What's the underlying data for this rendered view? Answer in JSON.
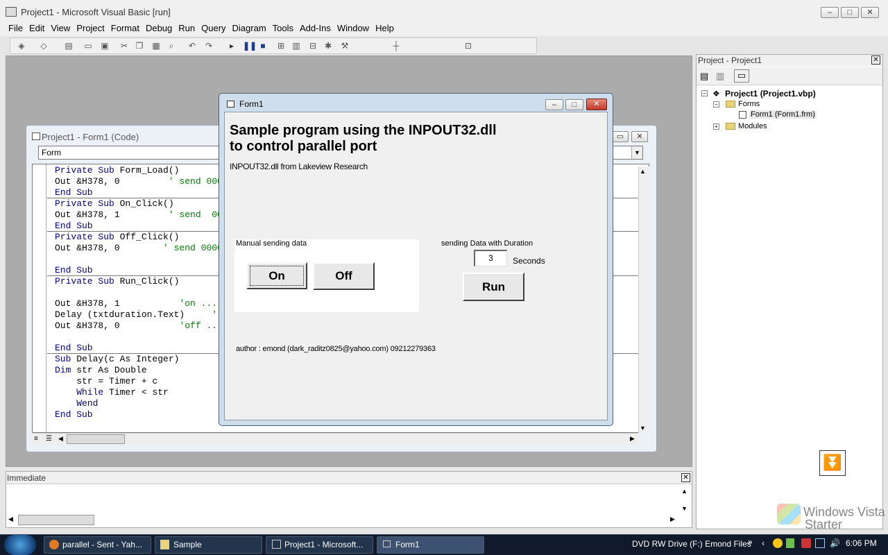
{
  "app": {
    "title": "Project1 - Microsoft Visual Basic [run]"
  },
  "menu": [
    "File",
    "Edit",
    "View",
    "Project",
    "Format",
    "Debug",
    "Run",
    "Query",
    "Diagram",
    "Tools",
    "Add-Ins",
    "Window",
    "Help"
  ],
  "code_window": {
    "title": "Project1 - Form1 (Code)",
    "object_combo": "Form",
    "lines": [
      {
        "kw": "Private Sub ",
        "rest": "Form_Load()",
        "cm": ""
      },
      {
        "kw": "",
        "rest": "Out &H378, 0         ",
        "cm": "' send 000"
      },
      {
        "kw": "End Sub",
        "rest": "",
        "cm": ""
      },
      {
        "kw": "Private Sub ",
        "rest": "On_Click()",
        "cm": ""
      },
      {
        "kw": "",
        "rest": "Out &H378, 1         ",
        "cm": "' send  00"
      },
      {
        "kw": "End Sub",
        "rest": "",
        "cm": ""
      },
      {
        "kw": "Private Sub ",
        "rest": "Off_Click()",
        "cm": ""
      },
      {
        "kw": "",
        "rest": "Out &H378, 0        ",
        "cm": "' send 0000"
      },
      {
        "kw": "",
        "rest": "",
        "cm": ""
      },
      {
        "kw": "End Sub",
        "rest": "",
        "cm": ""
      },
      {
        "kw": "Private Sub ",
        "rest": "Run_Click()",
        "cm": ""
      },
      {
        "kw": "",
        "rest": "",
        "cm": ""
      },
      {
        "kw": "",
        "rest": "Out &H378, 1           ",
        "cm": "'on ..."
      },
      {
        "kw": "",
        "rest": "Delay (txtduration.Text)     ",
        "cm": "'"
      },
      {
        "kw": "",
        "rest": "Out &H378, 0           ",
        "cm": "'off ..."
      },
      {
        "kw": "",
        "rest": "",
        "cm": ""
      },
      {
        "kw": "End Sub",
        "rest": "",
        "cm": ""
      },
      {
        "kw": "Sub ",
        "rest": "Delay(c As Integer)",
        "cm": ""
      },
      {
        "kw": "Dim ",
        "rest": "str As Double",
        "cm": ""
      },
      {
        "kw": "",
        "rest": "    str = Timer + c",
        "cm": ""
      },
      {
        "kw": "    While ",
        "rest": "Timer < str",
        "cm": ""
      },
      {
        "kw": "    Wend",
        "rest": "",
        "cm": ""
      },
      {
        "kw": "End Sub",
        "rest": "",
        "cm": ""
      }
    ]
  },
  "form1": {
    "title": "Form1",
    "heading_line1": "Sample program using the INPOUT32.dll",
    "heading_line2": "to control parallel port",
    "subtitle": "INPOUT32.dll  from Lakeview Research",
    "manual_label": "Manual sending data",
    "on_label": "On",
    "off_label": "Off",
    "duration_label": "sending Data with Duration",
    "duration_value": "3",
    "seconds_label": "Seconds",
    "run_label": "Run",
    "author": "author : emond (dark_raditz0825@yahoo.com) 09212279363"
  },
  "project_panel": {
    "title": "Project - Project1",
    "root": "Project1 (Project1.vbp)",
    "forms_folder": "Forms",
    "form_item": "Form1 (Form1.frm)",
    "modules_folder": "Modules"
  },
  "immediate": {
    "title": "Immediate"
  },
  "watermark": {
    "line1": "Windows Vista",
    "line2": "Starter"
  },
  "taskbar": {
    "tasks": [
      "parallel - Sent - Yah...",
      "Sample",
      "Project1 - Microsoft...",
      "Form1"
    ],
    "tray_text": "DVD RW Drive (F:) Emond Files",
    "chevron": "»",
    "clock": "6:06 PM"
  }
}
